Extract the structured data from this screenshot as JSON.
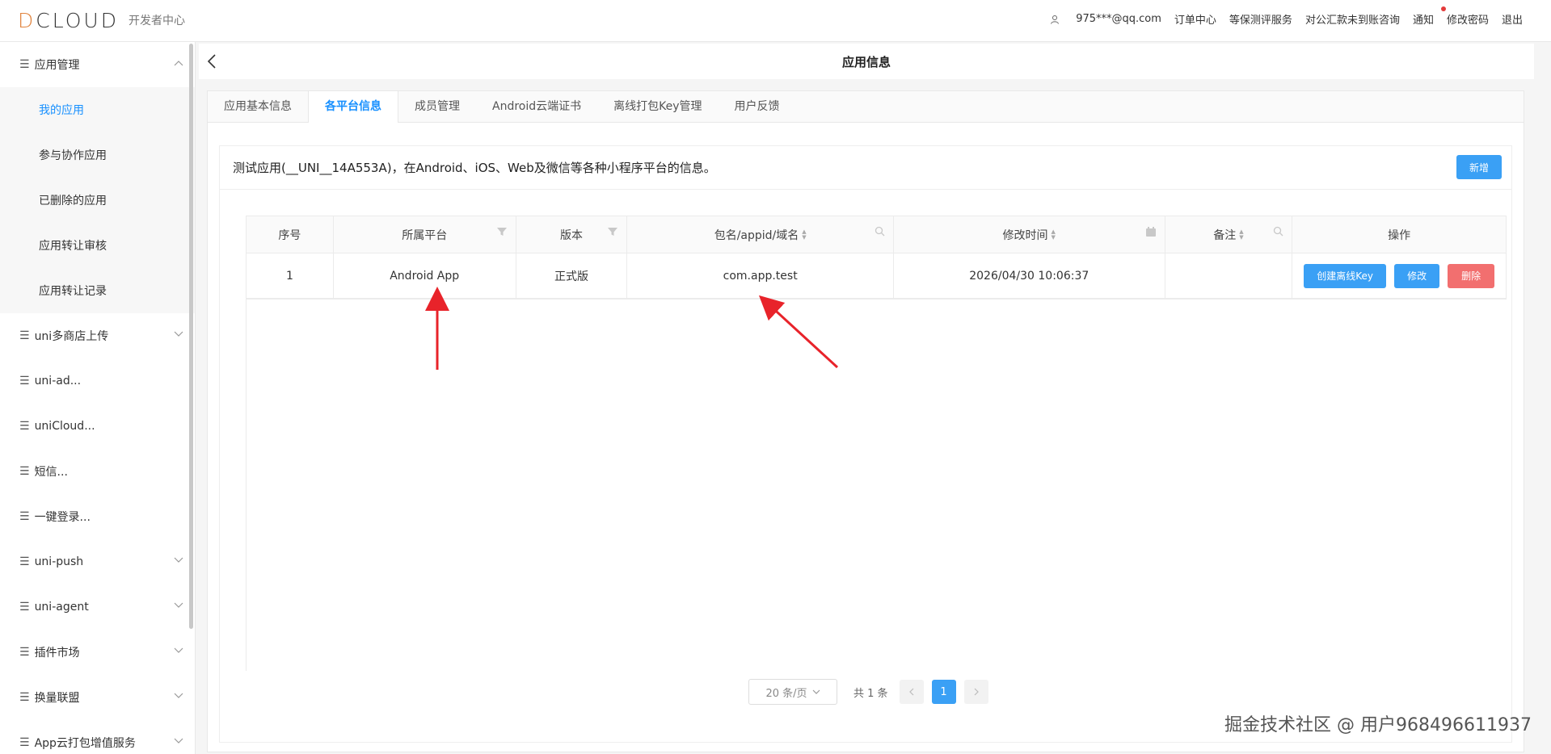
{
  "header": {
    "logo_text": "DCLOUD",
    "logo_sub": "开发者中心",
    "nav": {
      "user": "975***@qq.com",
      "orders": "订单中心",
      "security": "等保测评服务",
      "transfer": "对公汇款未到账咨询",
      "notice": "通知",
      "password": "修改密码",
      "logout": "退出"
    }
  },
  "sidebar": {
    "groups": [
      {
        "label": "应用管理"
      },
      {
        "label": "uni多商店上传"
      },
      {
        "label": "uni-ad..."
      },
      {
        "label": "uniCloud..."
      },
      {
        "label": "短信..."
      },
      {
        "label": "一键登录..."
      },
      {
        "label": "uni-push"
      },
      {
        "label": "uni-agent"
      },
      {
        "label": "插件市场"
      },
      {
        "label": "换量联盟"
      },
      {
        "label": "App云打包增值服务"
      }
    ],
    "app_items": [
      {
        "label": "我的应用"
      },
      {
        "label": "参与协作应用"
      },
      {
        "label": "已删除的应用"
      },
      {
        "label": "应用转让审核"
      },
      {
        "label": "应用转让记录"
      }
    ]
  },
  "page": {
    "title": "应用信息",
    "tabs": [
      {
        "label": "应用基本信息"
      },
      {
        "label": "各平台信息"
      },
      {
        "label": "成员管理"
      },
      {
        "label": "Android云端证书"
      },
      {
        "label": "离线打包Key管理"
      },
      {
        "label": "用户反馈"
      }
    ],
    "panel_title": "测试应用(__UNI__14A553A)，在Android、iOS、Web及微信等各种小程序平台的信息。",
    "add_label": "新增"
  },
  "table": {
    "headers": {
      "index": "序号",
      "platform": "所属平台",
      "version": "版本",
      "package": "包名/appid/域名",
      "modified": "修改时间",
      "remark": "备注",
      "actions": "操作"
    },
    "rows": [
      {
        "index": "1",
        "platform": "Android App",
        "version": "正式版",
        "package": "com.app.test",
        "modified": "2026/04/30 10:06:37",
        "remark": "",
        "create_key": "创建离线Key",
        "edit": "修改",
        "delete": "删除"
      }
    ]
  },
  "pager": {
    "page_size": "20 条/页",
    "total": "共 1 条",
    "current": "1"
  },
  "watermark": "掘金技术社区 @ 用户968496611937",
  "colors": {
    "primary": "#3aa0f5",
    "danger": "#f26f6f",
    "arrow": "#e8232a",
    "logo_accent": "#e0833d"
  }
}
